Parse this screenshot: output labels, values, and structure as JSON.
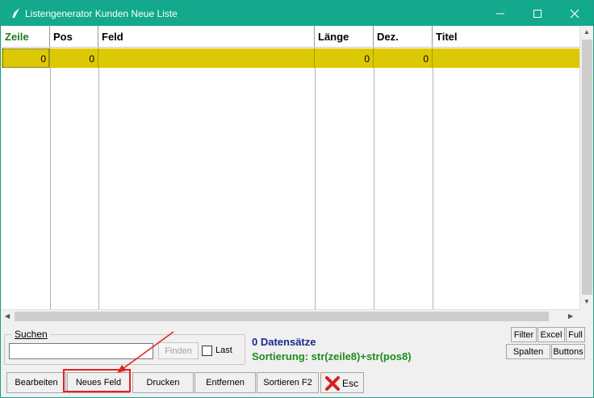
{
  "window": {
    "title": "Listengenerator Kunden Neue Liste"
  },
  "grid": {
    "columns": [
      "Zeile",
      "Pos",
      "Feld",
      "Länge",
      "Dez.",
      "Titel"
    ],
    "rows": [
      {
        "zeile": "0",
        "pos": "0",
        "feld": "",
        "laenge": "0",
        "dez": "0",
        "titel": ""
      }
    ]
  },
  "search": {
    "label": "Suchen",
    "value": "",
    "find_button": "Finden",
    "last_label": "Last"
  },
  "status": {
    "count": "0 Datensätze",
    "sort": "Sortierung: str(zeile8)+str(pos8)"
  },
  "small_buttons": {
    "filter": "Filter",
    "excel": "Excel",
    "full": "Full",
    "spalten": "Spalten",
    "buttons": "Buttons"
  },
  "buttons": {
    "bearbeiten": "Bearbeiten",
    "neues_feld": "Neues Feld",
    "drucken": "Drucken",
    "entfernen": "Entfernen",
    "sortieren": "Sortieren F2",
    "esc": "Esc"
  },
  "colors": {
    "titlebar": "#12a98c",
    "selected_row": "#dcc805",
    "sorted_header": "#1f7a1f",
    "count_text": "#1a2a8f",
    "sort_text": "#1f8c1f",
    "annotation": "#e52222"
  },
  "icons": {
    "app": "app-logo-icon",
    "minimize": "minimize-icon",
    "maximize": "maximize-icon",
    "close": "close-icon",
    "esc": "red-x-icon"
  }
}
